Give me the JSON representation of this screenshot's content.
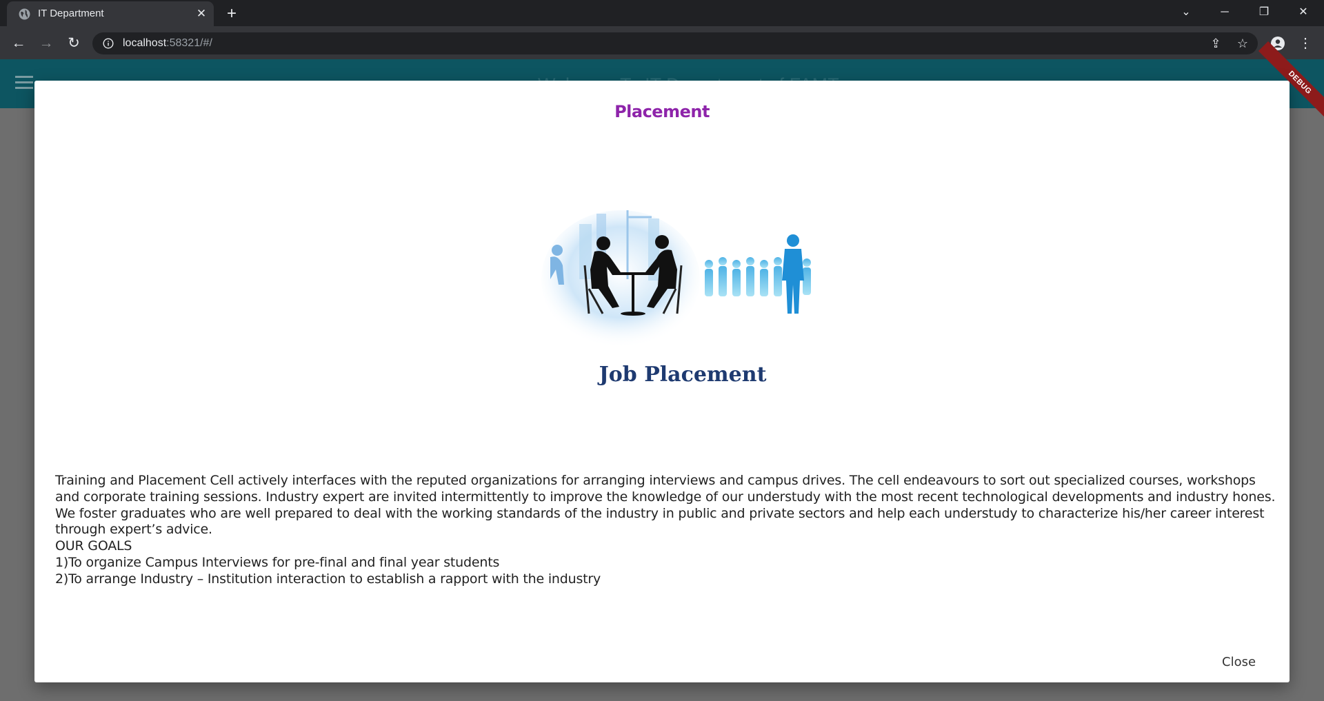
{
  "browser": {
    "tab_title": "IT Department",
    "url_host": "localhost",
    "url_rest": ":58321/#/"
  },
  "app": {
    "title": "Welcome To IT Department of FAMT",
    "debug_label": "DEBUG"
  },
  "modal": {
    "title": "Placement",
    "image_caption": "Job Placement",
    "paragraphs": [
      "Training and Placement Cell actively interfaces with the reputed organizations for arranging interviews and campus drives. The cell endeavours to sort out specialized courses, workshops and corporate training sessions. Industry expert are invited intermittently to improve the knowledge of our understudy with the most recent technological developments and industry hones. We foster graduates who are well prepared to deal with the working standards of the industry in public and private sectors and help each understudy to characterize his/her career interest through expert’s advice.",
      "OUR GOALS",
      "1)To organize Campus Interviews for pre-final and final year students",
      "2)To arrange Industry – Institution interaction to establish a rapport with the industry"
    ],
    "close_label": "Close"
  },
  "colors": {
    "accent_title": "#8e24aa",
    "appbar": "#0d5561",
    "debug_banner": "#8d1b1b"
  }
}
